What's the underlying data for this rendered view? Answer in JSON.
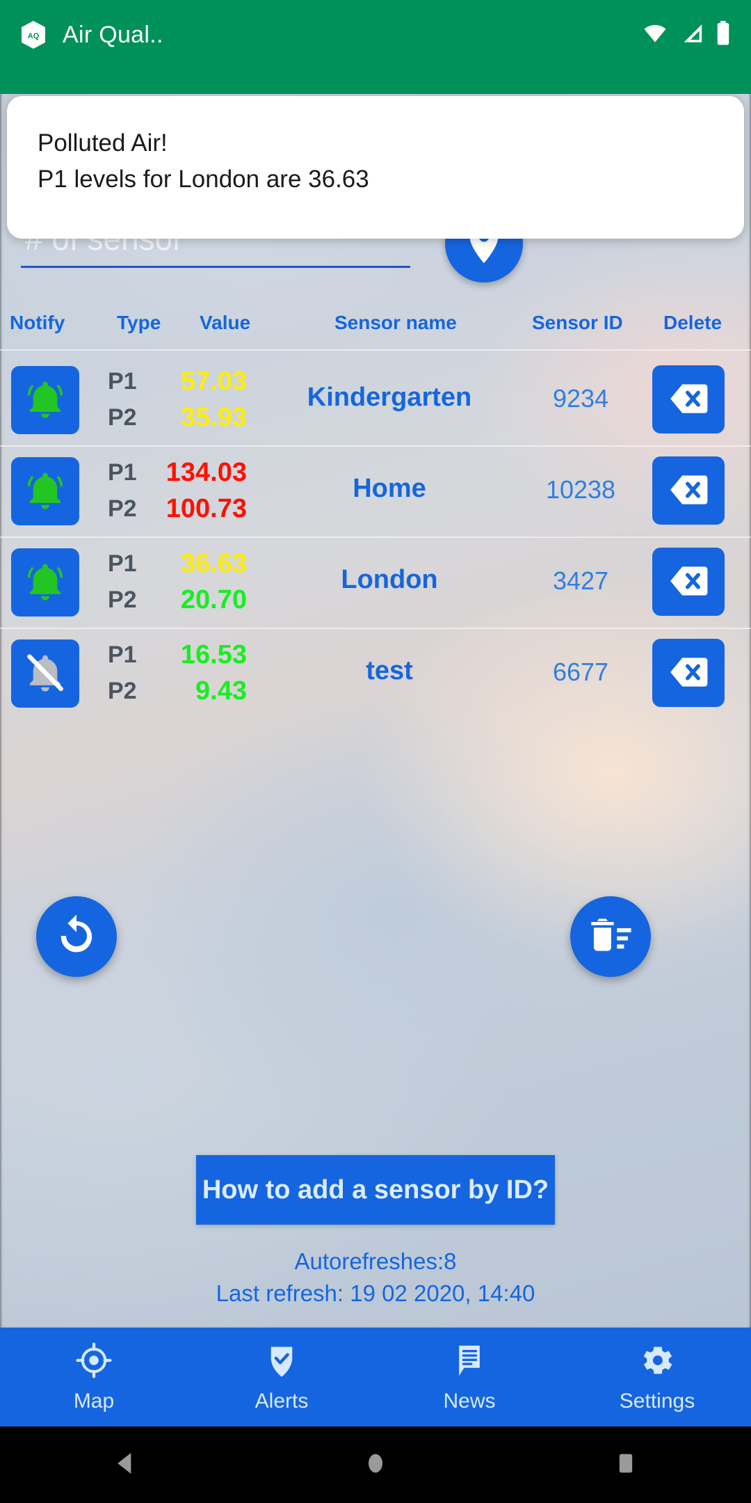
{
  "status_bar": {
    "app_icon_label": "AQ",
    "title": "Air Qual..",
    "icons": [
      "wifi-icon",
      "cellular-signal-icon",
      "battery-icon"
    ]
  },
  "notification": {
    "title": "Polluted Air!",
    "body": "P1 levels for London are 36.63"
  },
  "add_sensor": {
    "input_value": "",
    "placeholder": "# of sensor",
    "add_button_icon": "add-location-pin-icon"
  },
  "table": {
    "headers": {
      "notify": "Notify",
      "type": "Type",
      "value": "Value",
      "sensor_name": "Sensor name",
      "sensor_id": "Sensor ID",
      "delete": "Delete"
    },
    "rows": [
      {
        "notify_enabled": true,
        "notify_icon": "bell-active-icon",
        "p1_label": "P1",
        "p1_value": "57.03",
        "p1_color": "#ffee00",
        "p2_label": "P2",
        "p2_value": "35.93",
        "p2_color": "#ffee00",
        "name": "Kindergarten",
        "id": "9234",
        "delete_icon": "backspace-delete-icon"
      },
      {
        "notify_enabled": true,
        "notify_icon": "bell-active-icon",
        "p1_label": "P1",
        "p1_value": "134.03",
        "p1_color": "#ff1000",
        "p2_label": "P2",
        "p2_value": "100.73",
        "p2_color": "#ff1000",
        "name": "Home",
        "id": "10238",
        "delete_icon": "backspace-delete-icon"
      },
      {
        "notify_enabled": true,
        "notify_icon": "bell-active-icon",
        "p1_label": "P1",
        "p1_value": "36.63",
        "p1_color": "#ffee00",
        "p2_label": "P2",
        "p2_value": "20.70",
        "p2_color": "#17ee22",
        "name": "London",
        "id": "3427",
        "delete_icon": "backspace-delete-icon"
      },
      {
        "notify_enabled": false,
        "notify_icon": "bell-muted-icon",
        "p1_label": "P1",
        "p1_value": "16.53",
        "p1_color": "#17ee22",
        "p2_label": "P2",
        "p2_value": "9.43",
        "p2_color": "#17ee22",
        "name": "test",
        "id": "6677",
        "delete_icon": "backspace-delete-icon"
      }
    ]
  },
  "actions": {
    "refresh_icon": "refresh-icon",
    "clear_all_icon": "delete-sweep-icon",
    "help_label": "How to add a sensor by ID?"
  },
  "refresh_info": {
    "autorefreshes": "Autorefreshes:8",
    "last_refresh": "Last refresh: 19 02 2020, 14:40"
  },
  "bottom_nav": {
    "items": [
      {
        "label": "Map",
        "icon": "gps-target-icon"
      },
      {
        "label": "Alerts",
        "icon": "shield-check-icon"
      },
      {
        "label": "News",
        "icon": "article-bubble-icon"
      },
      {
        "label": "Settings",
        "icon": "gear-icon"
      }
    ]
  },
  "system_nav": {
    "back": "back-triangle-icon",
    "home": "home-circle-icon",
    "recents": "recents-square-icon"
  },
  "colors": {
    "app_bar_green": "#00915a",
    "accent_blue": "#1565e0",
    "link_blue": "#1566dd",
    "level_good": "#17ee22",
    "level_moderate": "#ffee00",
    "level_bad": "#ff1000"
  }
}
